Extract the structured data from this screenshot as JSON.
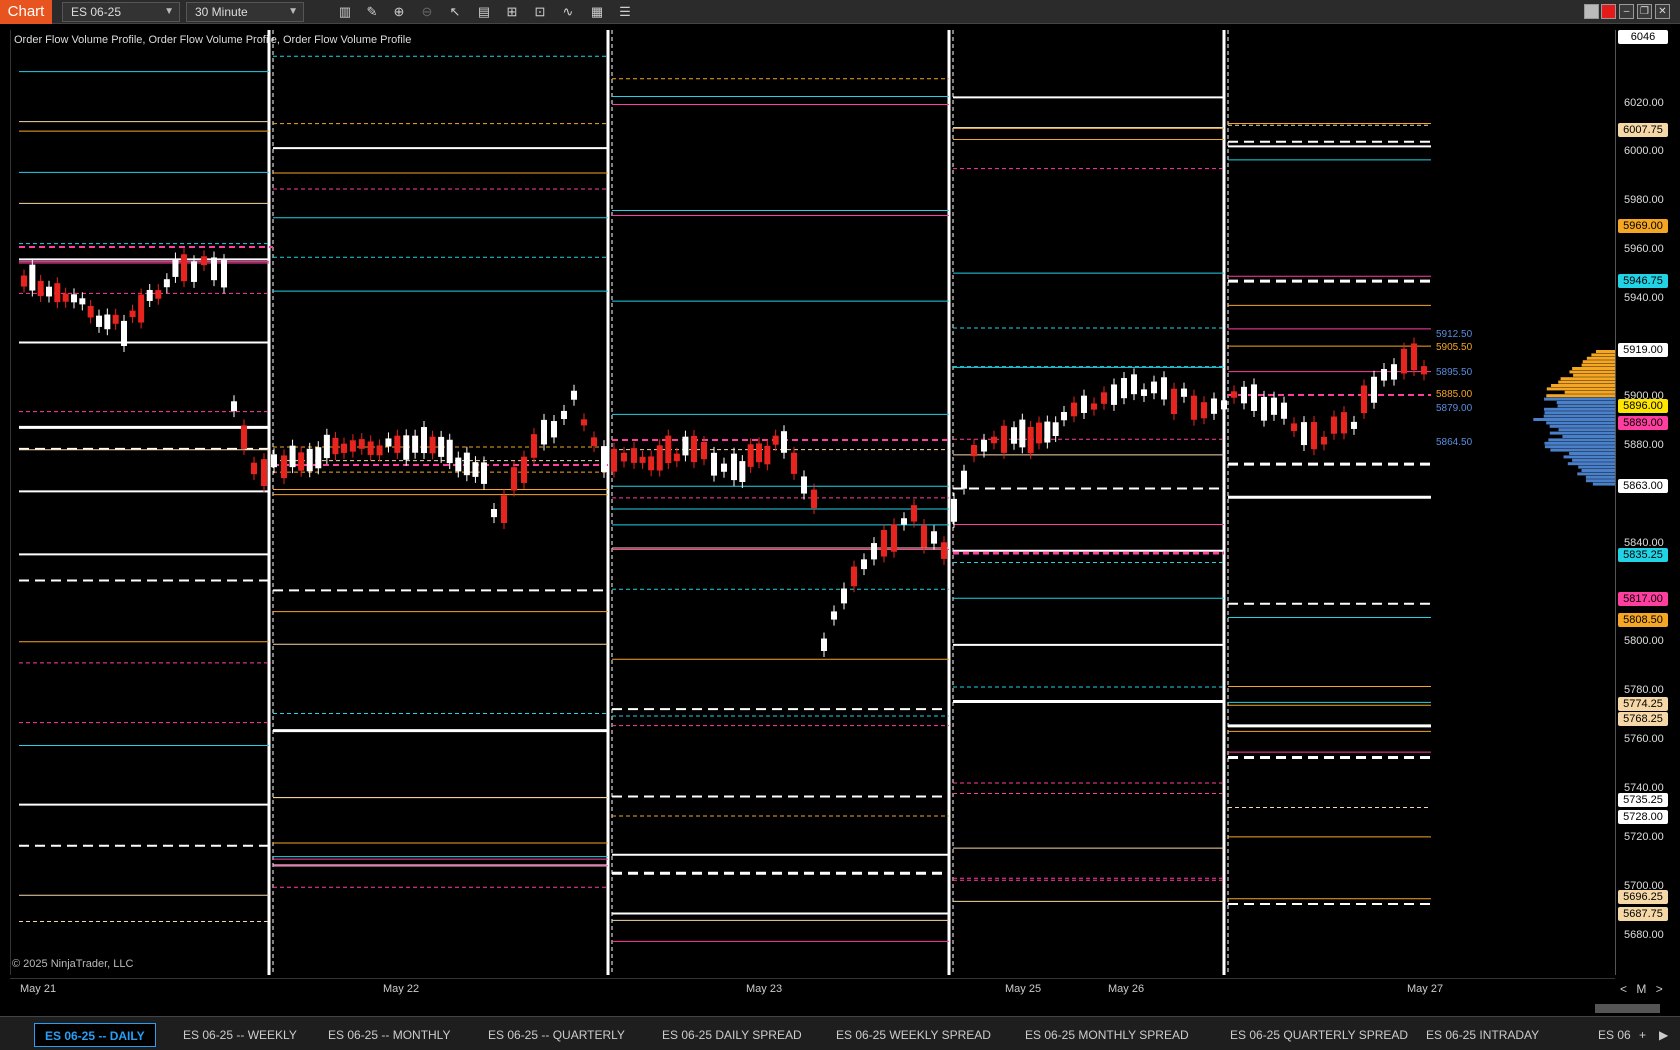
{
  "toolbar": {
    "chart_label": "Chart",
    "instrument": "ES 06-25",
    "interval": "30 Minute"
  },
  "plot": {
    "indicator_label": "Order Flow Volume Profile, Order Flow Volume Profile, Order Flow Volume Profile",
    "copyright": "© 2025 NinjaTrader, LLC"
  },
  "date_axis": [
    "May 21",
    "May 22",
    "May 23",
    "May 25",
    "May 26",
    "May 27"
  ],
  "price_axis": {
    "ticks": [
      "6020.00",
      "6000.00",
      "5980.00",
      "5960.00",
      "5940.00",
      "5900.00",
      "5880.00",
      "5840.00",
      "5800.00",
      "5780.00",
      "5760.00",
      "5740.00",
      "5720.00",
      "5700.00",
      "5680.00"
    ],
    "badges": [
      {
        "text": "6046",
        "color": "#ffffff"
      },
      {
        "text": "6007.75",
        "color": "#f6d7a6"
      },
      {
        "text": "5969.00",
        "color": "#f5a623"
      },
      {
        "text": "5946.75",
        "color": "#22d3e6"
      },
      {
        "text": "5919.00",
        "color": "#ffffff"
      },
      {
        "text": "5896.00",
        "color": "#ffe600"
      },
      {
        "text": "5889.00",
        "color": "#ff3fa0"
      },
      {
        "text": "5863.00",
        "color": "#ffffff"
      },
      {
        "text": "5835.25",
        "color": "#22d3e6"
      },
      {
        "text": "5817.00",
        "color": "#ff3fa0"
      },
      {
        "text": "5808.50",
        "color": "#f5a623"
      },
      {
        "text": "5774.25",
        "color": "#f6d7a6"
      },
      {
        "text": "5768.25",
        "color": "#f6d7a6"
      },
      {
        "text": "5735.25",
        "color": "#ffffff"
      },
      {
        "text": "5728.00",
        "color": "#ffffff"
      },
      {
        "text": "5696.25",
        "color": "#f6d7a6"
      },
      {
        "text": "5687.75",
        "color": "#f6d7a6"
      }
    ]
  },
  "profile_labels": [
    "5912.50",
    "5905.50",
    "5895.50",
    "5885.00",
    "5879.00",
    "5864.50"
  ],
  "zoom_controls": {
    "prev": "<",
    "mode": "M",
    "next": ">"
  },
  "tabs": [
    {
      "label": "ES 06-25 -- DAILY",
      "active": true
    },
    {
      "label": "ES 06-25 -- WEEKLY",
      "active": false
    },
    {
      "label": "ES 06-25 -- MONTHLY",
      "active": false
    },
    {
      "label": "ES 06-25 -- QUARTERLY",
      "active": false
    },
    {
      "label": "ES 06-25 DAILY SPREAD",
      "active": false
    },
    {
      "label": "ES 06-25 WEEKLY SPREAD",
      "active": false
    },
    {
      "label": "ES 06-25 MONTHLY SPREAD",
      "active": false
    },
    {
      "label": "ES 06-25 QUARTERLY SPREAD",
      "active": false
    },
    {
      "label": "ES 06-25 INTRADAY",
      "active": false
    },
    {
      "label": "ES 06",
      "active": false
    }
  ],
  "colors": {
    "up_candle": "#ffffff",
    "down_candle": "#e8241f",
    "orange": "#f5a623",
    "cyan": "#22d3e6",
    "magenta": "#ff3fa0",
    "white": "#ffffff",
    "accent": "#e8541f"
  }
}
